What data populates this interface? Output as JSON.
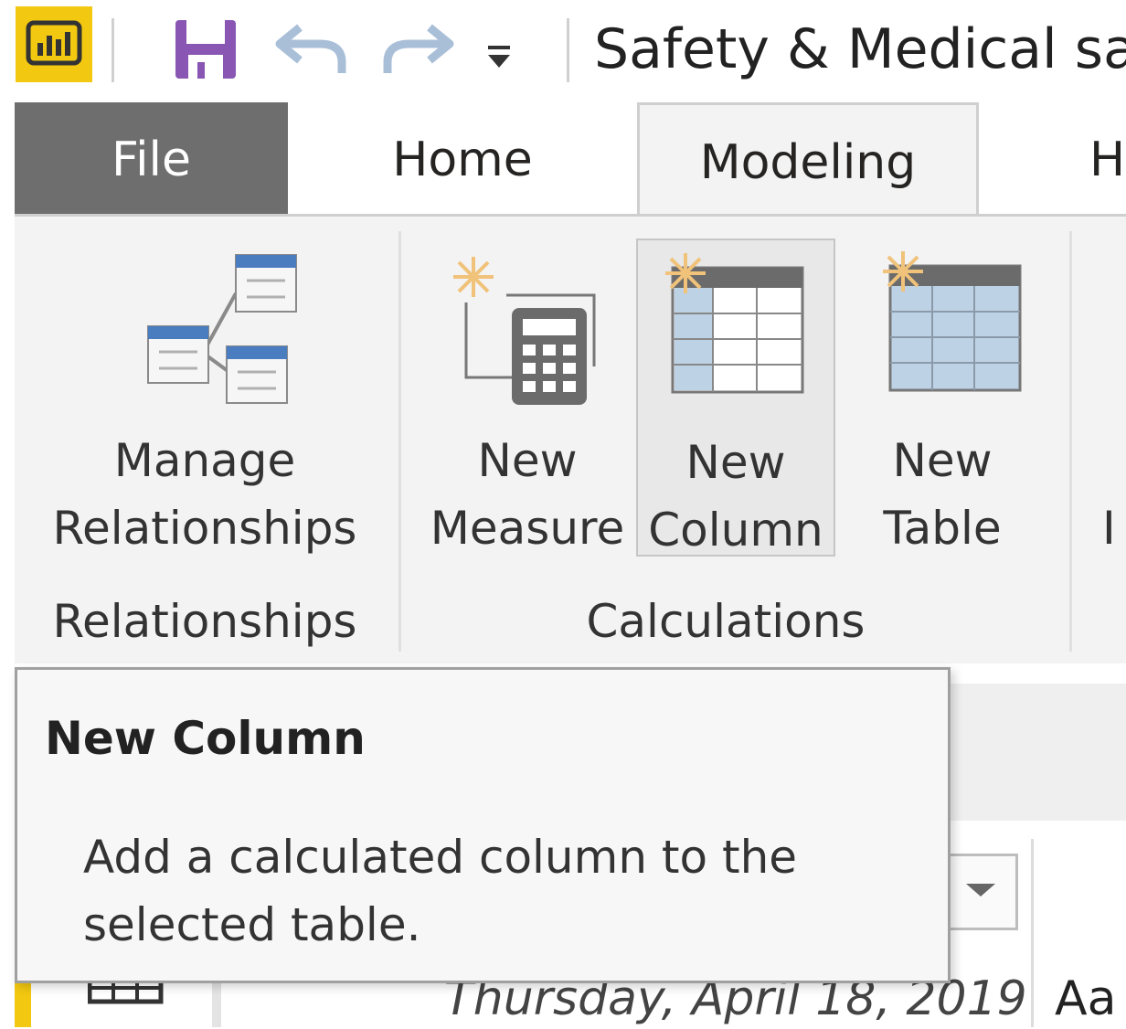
{
  "titlebar": {
    "title": "Safety & Medical sal",
    "app_icon": "power-bi-logo",
    "quick_access": {
      "save_icon": "save-icon",
      "undo_icon": "undo-icon",
      "redo_icon": "redo-icon",
      "customize_icon": "customize-quick-access-icon"
    }
  },
  "tabs": [
    {
      "label": "File"
    },
    {
      "label": "Home"
    },
    {
      "label": "Modeling",
      "active": true
    },
    {
      "label": "H"
    }
  ],
  "ribbon": {
    "groups": [
      {
        "label": "Relationships",
        "buttons": [
          {
            "line1": "Manage",
            "line2": "Relationships",
            "icon": "manage-relationships-icon"
          }
        ]
      },
      {
        "label": "Calculations",
        "buttons": [
          {
            "line1": "New",
            "line2": "Measure",
            "icon": "new-measure-icon"
          },
          {
            "line1": "New",
            "line2": "Column",
            "icon": "new-column-icon",
            "hovered": true
          },
          {
            "line1": "New",
            "line2": "Table",
            "icon": "new-table-icon"
          }
        ]
      }
    ],
    "partial_next_label": "I"
  },
  "tooltip": {
    "title": "New Column",
    "body": "Add a calculated column to the selected table."
  },
  "table_behind": {
    "date_value": "Thursday, April 18, 2019",
    "next_value": "Aa"
  },
  "colors": {
    "brand_yellow": "#f2c811",
    "file_tab": "#6e6e6e",
    "save_purple": "#8a56b3",
    "undo_blue": "#a9bfd8"
  }
}
